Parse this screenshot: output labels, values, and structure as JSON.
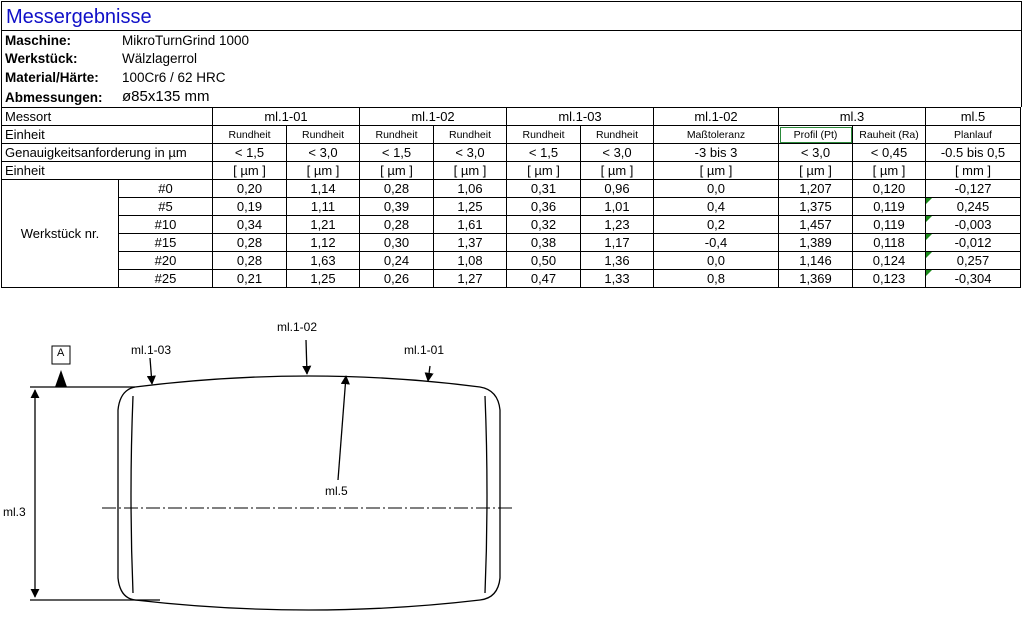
{
  "title": "Messergebnisse",
  "info": [
    {
      "label": "Maschine:",
      "value": "MikroTurnGrind 1000"
    },
    {
      "label": "Werkstück:",
      "value": "Wälzlagerrol"
    },
    {
      "label": "Material/Härte:",
      "value": "100Cr6 / 62 HRC"
    },
    {
      "label": "Abmessungen:",
      "value": "ø85x135 mm"
    }
  ],
  "table": {
    "messort_label": "Messort",
    "messort": [
      "ml.1-01",
      "ml.1-02",
      "ml.1-03",
      "ml.1-02",
      "ml.3",
      "ml.5"
    ],
    "einheit_label": "Einheit",
    "einheit": [
      "Rundheit",
      "Rundheit",
      "Rundheit",
      "Rundheit",
      "Rundheit",
      "Rundheit",
      "Maßtoleranz",
      "Profil (Pt)",
      "Rauheit (Ra)",
      "Planlauf"
    ],
    "anforderung_label": "Genauigkeitsanforderung in µm",
    "anforderung": [
      "< 1,5",
      "< 3,0",
      "< 1,5",
      "< 3,0",
      "< 1,5",
      "< 3,0",
      "-3 bis 3",
      "< 3,0",
      "< 0,45",
      "-0.5 bis 0,5"
    ],
    "einheit2_label": "Einheit",
    "einheit2": [
      "[ µm ]",
      "[ µm ]",
      "[ µm ]",
      "[ µm ]",
      "[ µm ]",
      "[ µm ]",
      "[ µm ]",
      "[ µm ]",
      "[ µm ]",
      "[ mm ]"
    ],
    "werkstueck_label": "Werkstück nr.",
    "rows": [
      {
        "id": "#0",
        "v": [
          "0,20",
          "1,14",
          "0,28",
          "1,06",
          "0,31",
          "0,96",
          "0,0",
          "1,207",
          "0,120",
          "-0,127"
        ]
      },
      {
        "id": "#5",
        "v": [
          "0,19",
          "1,11",
          "0,39",
          "1,25",
          "0,36",
          "1,01",
          "0,4",
          "1,375",
          "0,119",
          "0,245"
        ]
      },
      {
        "id": "#10",
        "v": [
          "0,34",
          "1,21",
          "0,28",
          "1,61",
          "0,32",
          "1,23",
          "0,2",
          "1,457",
          "0,119",
          "-0,003"
        ]
      },
      {
        "id": "#15",
        "v": [
          "0,28",
          "1,12",
          "0,30",
          "1,37",
          "0,38",
          "1,17",
          "-0,4",
          "1,389",
          "0,118",
          "-0,012"
        ]
      },
      {
        "id": "#20",
        "v": [
          "0,28",
          "1,63",
          "0,24",
          "1,08",
          "0,50",
          "1,36",
          "0,0",
          "1,146",
          "0,124",
          "0,257"
        ]
      },
      {
        "id": "#25",
        "v": [
          "0,21",
          "1,25",
          "0,26",
          "1,27",
          "0,47",
          "1,33",
          "0,8",
          "1,369",
          "0,123",
          "-0,304"
        ]
      }
    ]
  },
  "drawing": {
    "datum": "A",
    "labels": {
      "ml_1_03": "ml.1-03",
      "ml_1_02": "ml.1-02",
      "ml_1_01": "ml.1-01",
      "ml_5": "ml.5",
      "ml_3": "ml.3"
    }
  }
}
